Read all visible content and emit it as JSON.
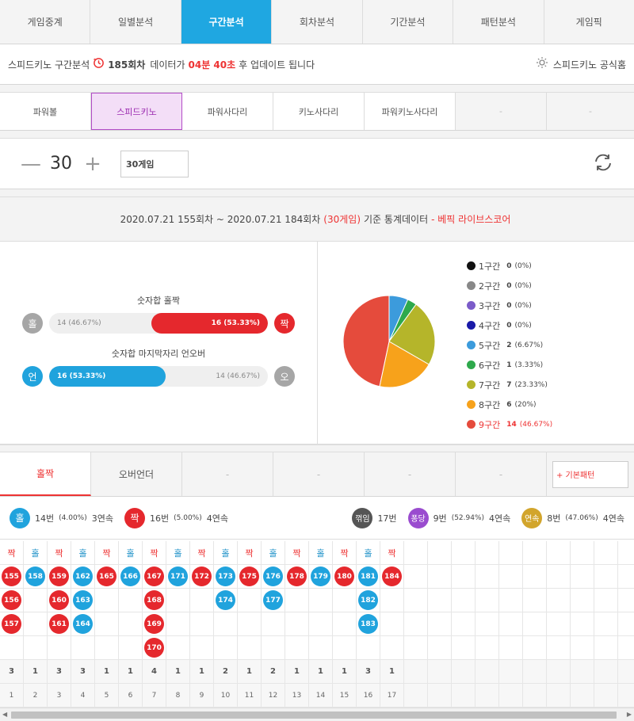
{
  "main_tabs": [
    "게임중계",
    "일별분석",
    "구간분석",
    "회차분석",
    "기간분석",
    "패턴분석",
    "게임픽"
  ],
  "info": {
    "prefix": "스피드키노 구간분석",
    "round": "185회차",
    "mid": "데이터가",
    "time": "04분 40초",
    "suffix": "후 업데이트 됩니다",
    "homepage": "스피드키노 공식홈"
  },
  "game_tabs": [
    "파워볼",
    "스피드키노",
    "파워사다리",
    "키노사다리",
    "파워키노사다리",
    "-",
    "-"
  ],
  "counter": {
    "minus": "—",
    "value": "30",
    "plus": "+",
    "select": "30게임"
  },
  "stat_header": {
    "range": "2020.07.21 155회차 ~ 2020.07.21 184회차",
    "games": "(30게임)",
    "mid": "기준 통계데이터",
    "brand": "- 베픽 라이브스코어"
  },
  "oddeven": {
    "title": "숫자합 홀짝",
    "left_label": "홀",
    "left_text": "14 (46.67%)",
    "left_pct": 46.67,
    "right_label": "짝",
    "right_text": "16 (53.33%)",
    "right_pct": 53.33
  },
  "underover": {
    "title": "숫자합 마지막자리 언오버",
    "left_label": "언",
    "left_text": "16 (53.33%)",
    "left_pct": 53.33,
    "right_label": "오",
    "right_text": "14 (46.67%)",
    "right_pct": 46.67
  },
  "chart_data": {
    "type": "pie",
    "labels": [
      "1구간",
      "2구간",
      "3구간",
      "4구간",
      "5구간",
      "6구간",
      "7구간",
      "8구간",
      "9구간"
    ],
    "counts": [
      "0",
      "0",
      "0",
      "0",
      "2",
      "1",
      "7",
      "6",
      "14"
    ],
    "pcts": [
      "(0%)",
      "(0%)",
      "(0%)",
      "(0%)",
      "(6.67%)",
      "(3.33%)",
      "(23.33%)",
      "(20%)",
      "(46.67%)"
    ],
    "values": [
      0,
      0,
      0,
      0,
      2,
      1,
      7,
      6,
      14
    ],
    "colors": [
      "#111111",
      "#888888",
      "#7b5cc9",
      "#1a1aa8",
      "#3c9bdc",
      "#2ea94c",
      "#b5b52a",
      "#f7a21b",
      "#e54b3c"
    ]
  },
  "pattern_tabs": [
    "홀짝",
    "오버언더",
    "-",
    "-",
    "-",
    "-"
  ],
  "basic_pattern": "+ 기본패턴",
  "summary": {
    "odd": {
      "label": "홀",
      "text": "14번",
      "pct": "(4.00%)",
      "streak": "3연속"
    },
    "even": {
      "label": "짝",
      "text": "16번",
      "pct": "(5.00%)",
      "streak": "4연속"
    },
    "break": {
      "label": "꺾임",
      "text": "17번"
    },
    "pong": {
      "label": "퐁당",
      "text": "9번",
      "pct": "(52.94%)",
      "streak": "4연속"
    },
    "cont": {
      "label": "연속",
      "text": "8번",
      "pct": "(47.06%)",
      "streak": "4연속"
    }
  },
  "pattern_grid": {
    "columns": [
      {
        "head": "짝",
        "type": "even",
        "rounds": [
          "155",
          "156",
          "157"
        ],
        "count": "3",
        "idx": "1"
      },
      {
        "head": "홀",
        "type": "odd",
        "rounds": [
          "158"
        ],
        "count": "1",
        "idx": "2"
      },
      {
        "head": "짝",
        "type": "even",
        "rounds": [
          "159",
          "160",
          "161"
        ],
        "count": "3",
        "idx": "3"
      },
      {
        "head": "홀",
        "type": "odd",
        "rounds": [
          "162",
          "163",
          "164"
        ],
        "count": "3",
        "idx": "4"
      },
      {
        "head": "짝",
        "type": "even",
        "rounds": [
          "165"
        ],
        "count": "1",
        "idx": "5"
      },
      {
        "head": "홀",
        "type": "odd",
        "rounds": [
          "166"
        ],
        "count": "1",
        "idx": "6"
      },
      {
        "head": "짝",
        "type": "even",
        "rounds": [
          "167",
          "168",
          "169",
          "170"
        ],
        "count": "4",
        "idx": "7"
      },
      {
        "head": "홀",
        "type": "odd",
        "rounds": [
          "171"
        ],
        "count": "1",
        "idx": "8"
      },
      {
        "head": "짝",
        "type": "even",
        "rounds": [
          "172"
        ],
        "count": "1",
        "idx": "9"
      },
      {
        "head": "홀",
        "type": "odd",
        "rounds": [
          "173",
          "174"
        ],
        "count": "2",
        "idx": "10"
      },
      {
        "head": "짝",
        "type": "even",
        "rounds": [
          "175"
        ],
        "count": "1",
        "idx": "11"
      },
      {
        "head": "홀",
        "type": "odd",
        "rounds": [
          "176",
          "177"
        ],
        "count": "2",
        "idx": "12"
      },
      {
        "head": "짝",
        "type": "even",
        "rounds": [
          "178"
        ],
        "count": "1",
        "idx": "13"
      },
      {
        "head": "홀",
        "type": "odd",
        "rounds": [
          "179"
        ],
        "count": "1",
        "idx": "14"
      },
      {
        "head": "짝",
        "type": "even",
        "rounds": [
          "180"
        ],
        "count": "1",
        "idx": "15"
      },
      {
        "head": "홀",
        "type": "odd",
        "rounds": [
          "181",
          "182",
          "183"
        ],
        "count": "3",
        "idx": "16"
      },
      {
        "head": "짝",
        "type": "even",
        "rounds": [
          "184"
        ],
        "count": "1",
        "idx": "17"
      }
    ]
  }
}
